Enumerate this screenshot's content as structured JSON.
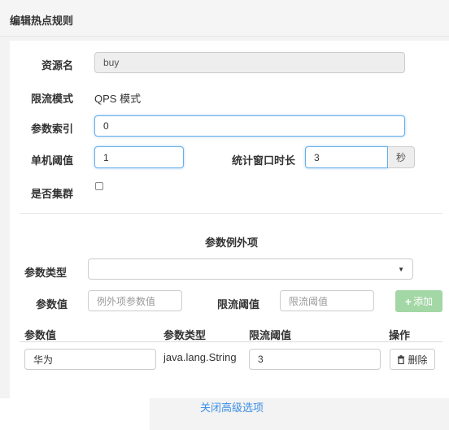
{
  "modal": {
    "title": "编辑热点规则"
  },
  "form": {
    "resource_label": "资源名",
    "resource_value": "buy",
    "mode_label": "限流模式",
    "mode_value": "QPS 模式",
    "param_index_label": "参数索引",
    "param_index_value": "0",
    "threshold_label": "单机阈值",
    "threshold_value": "1",
    "window_label": "统计窗口时长",
    "window_value": "3",
    "window_unit": "秒",
    "cluster_label": "是否集群",
    "cluster_checked": false
  },
  "exceptions": {
    "title": "参数例外项",
    "type_label": "参数类型",
    "type_value": "",
    "value_label": "参数值",
    "value_placeholder": "例外项参数值",
    "limit_label": "限流阈值",
    "limit_placeholder": "限流阈值",
    "add_label": "添加",
    "table": {
      "headers": [
        "参数值",
        "参数类型",
        "限流阈值",
        "操作"
      ],
      "rows": [
        {
          "value": "华为",
          "type": "java.lang.String",
          "limit": "3",
          "action_label": "删除"
        }
      ]
    }
  },
  "footer": {
    "link_label": "关闭高级选项"
  },
  "colors": {
    "accent_blue": "#66afe9",
    "add_button_green": "#a3d7a5",
    "link_blue": "#3a8ee6"
  }
}
